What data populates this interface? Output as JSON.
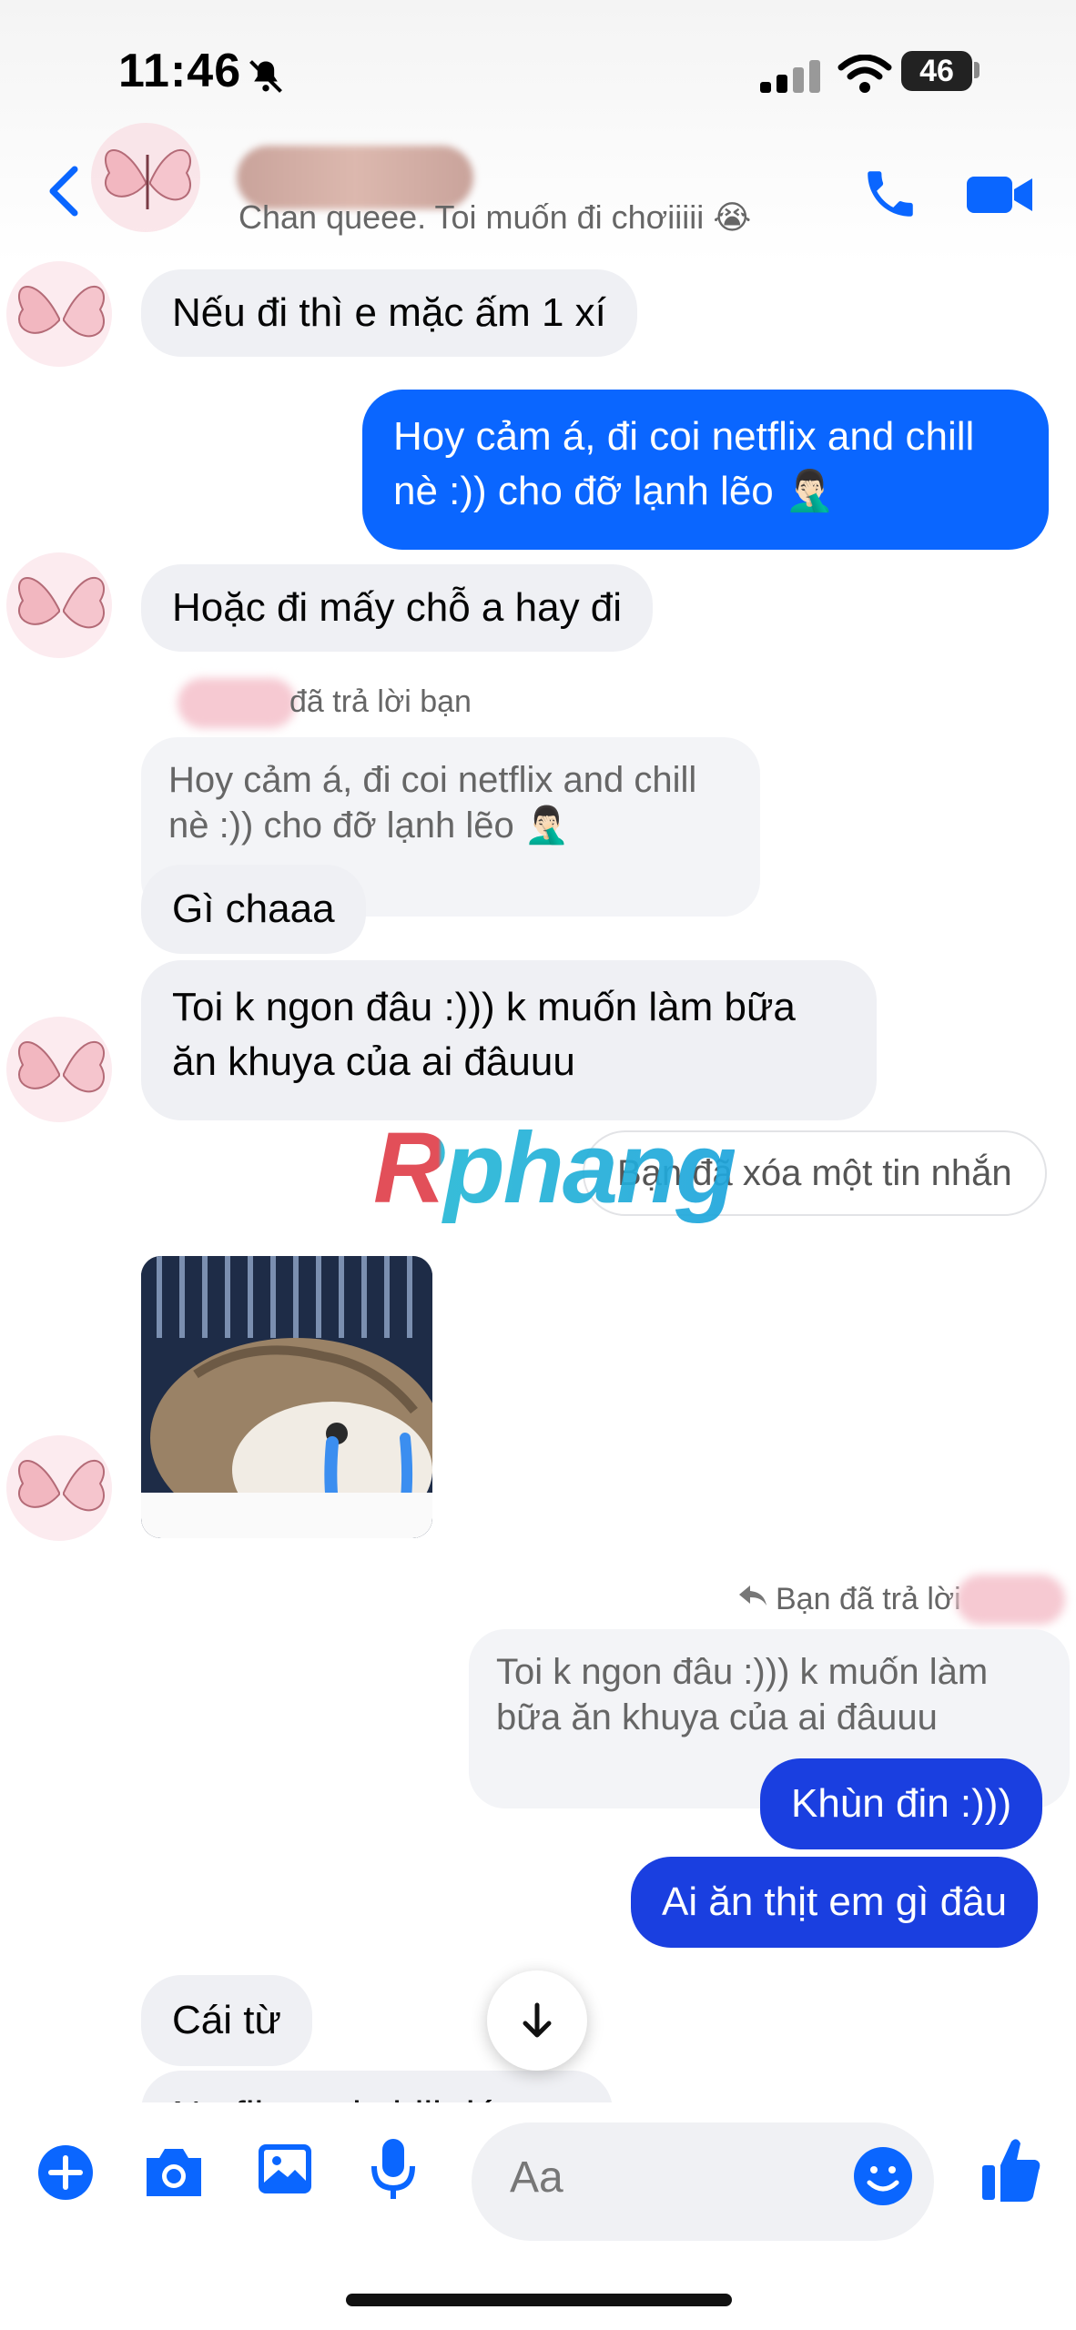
{
  "status_bar": {
    "time": "11:46",
    "battery": "46"
  },
  "header": {
    "status_text": "Chan queee. Toi muốn đi chơiiiii 😭"
  },
  "messages": {
    "m1": "Nếu đi thì e mặc ấm 1 xí",
    "m2_line1": "Hoy cảm á, đi coi netflix and chill",
    "m2_line2": "nè :)) cho đỡ lạnh lẽo 🤦🏻‍♂️",
    "m3": "Hoặc đi mấy chỗ a hay đi",
    "reply_label_1": "đã trả lời bạn",
    "quote1_line1": "Hoy cảm á, đi coi netflix and chill",
    "quote1_line2": "nè :)) cho đỡ lạnh lẽo 🤦🏻‍♂️",
    "m4": "Gì chaaa",
    "m5_line1": "Toi k ngon đâu :))) k muốn làm bữa",
    "m5_line2": "ăn khuya của ai đâuuu",
    "deleted": "Bạn đã xóa một tin nhắn",
    "reply_label_2": "Bạn đã trả lời",
    "quote2_line1": "Toi k ngon đâu :))) k muốn làm",
    "quote2_line2": "bữa ăn khuya của ai đâuuu",
    "m6": "Khùn đin :)))",
    "m7": "Ai ăn thịt em gì đâu",
    "m8": "Cái từ",
    "m9_partial": "Netflix and chill đó"
  },
  "watermark": "Rphang",
  "composer": {
    "placeholder": "Aa"
  },
  "colors": {
    "outgoing": "#0a66ff",
    "outgoing_dark": "#1a3fe0",
    "incoming": "#eff0f4",
    "accent": "#0a66ff"
  }
}
